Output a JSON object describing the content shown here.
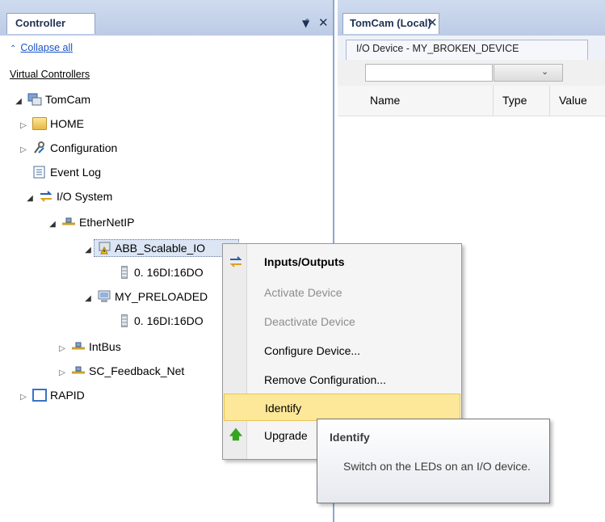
{
  "left_panel": {
    "tab_label": "Controller",
    "collapse_all": "Collapse all",
    "virtual_controllers": "Virtual Controllers",
    "tree": {
      "root": "TomCam",
      "home": "HOME",
      "configuration": "Configuration",
      "event_log": "Event Log",
      "io_system": "I/O System",
      "ethernetip": "EtherNetIP",
      "abb_scalable": "ABB_Scalable_IO",
      "signal_1": "0. 16DI:16DO",
      "my_preloaded": "MY_PRELOADED",
      "signal_2": "0. 16DI:16DO",
      "intbus": "IntBus",
      "sc_feedback": "SC_Feedback_Net",
      "rapid": "RAPID"
    }
  },
  "right_panel": {
    "tab_label": "TomCam (Local)",
    "device_tab": "I/O Device - MY_BROKEN_DEVICE",
    "columns": [
      "Name",
      "Type",
      "Value"
    ]
  },
  "context_menu": {
    "items": [
      {
        "label": "Inputs/Outputs",
        "state": "bold"
      },
      {
        "label": "Activate Device",
        "state": "disabled"
      },
      {
        "label": "Deactivate Device",
        "state": "disabled"
      },
      {
        "label": "Configure Device...",
        "state": "enabled"
      },
      {
        "label": "Remove Configuration...",
        "state": "enabled"
      },
      {
        "label": "Identify",
        "state": "highlighted"
      },
      {
        "label": "Upgrade",
        "state": "enabled"
      }
    ]
  },
  "tooltip": {
    "title": "Identify",
    "text": "Switch on the LEDs on an I/O device."
  },
  "colors": {
    "header_bg": "#c6d4ec",
    "highlight": "#fce898",
    "link": "#1a53c8"
  },
  "icons": {
    "collapse": "double-chevron-up-icon",
    "pin": "pin-icon",
    "close": "close-icon",
    "folder": "folder-icon",
    "warning": "warning-icon",
    "green_arrow": "arrow-up-green-icon"
  }
}
